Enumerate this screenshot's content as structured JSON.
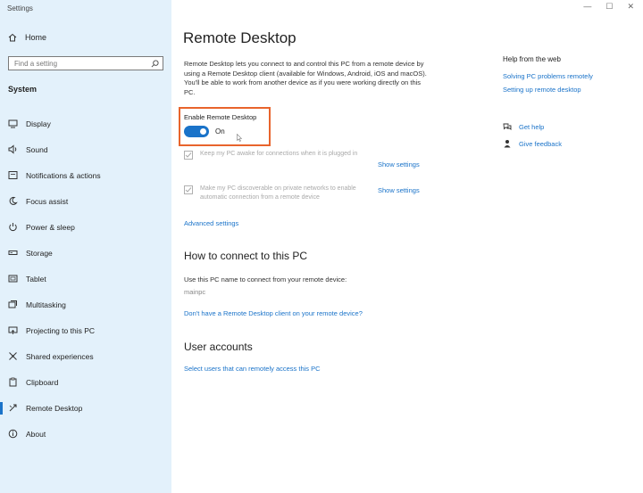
{
  "window": {
    "title": "Settings",
    "controls": [
      "—",
      "☐",
      "✕"
    ]
  },
  "sidebar": {
    "home_label": "Home",
    "search_placeholder": "Find a setting",
    "section": "System",
    "items": [
      {
        "label": "Display",
        "icon": "display-icon"
      },
      {
        "label": "Sound",
        "icon": "sound-icon"
      },
      {
        "label": "Notifications & actions",
        "icon": "notifications-icon"
      },
      {
        "label": "Focus assist",
        "icon": "moon-icon"
      },
      {
        "label": "Power & sleep",
        "icon": "power-icon"
      },
      {
        "label": "Storage",
        "icon": "storage-icon"
      },
      {
        "label": "Tablet",
        "icon": "tablet-icon"
      },
      {
        "label": "Multitasking",
        "icon": "multitasking-icon"
      },
      {
        "label": "Projecting to this PC",
        "icon": "projecting-icon"
      },
      {
        "label": "Shared experiences",
        "icon": "shared-icon"
      },
      {
        "label": "Clipboard",
        "icon": "clipboard-icon"
      },
      {
        "label": "Remote Desktop",
        "icon": "remote-desktop-icon",
        "active": true
      },
      {
        "label": "About",
        "icon": "info-icon"
      }
    ]
  },
  "main": {
    "title": "Remote Desktop",
    "description": "Remote Desktop lets you connect to and control this PC from a remote device by using a Remote Desktop client (available for Windows, Android, iOS and macOS). You'll be able to work from another device as if you were working directly on this PC.",
    "toggle": {
      "label": "Enable Remote Desktop",
      "state": "On",
      "on": true,
      "accent": "#1a73c9",
      "highlight": "#e8642c"
    },
    "options": [
      {
        "text": "Keep my PC awake for connections when it is plugged in",
        "link": "Show settings",
        "checked": true
      },
      {
        "text": "Make my PC discoverable on private networks to enable automatic connection from a remote device",
        "link": "Show settings",
        "checked": true
      }
    ],
    "advanced_link": "Advanced settings",
    "connect": {
      "heading": "How to connect to this PC",
      "text": "Use this PC name to connect from your remote device:",
      "pc_name": "mainpc",
      "client_link": "Don't have a Remote Desktop client on your remote device?"
    },
    "accounts": {
      "heading": "User accounts",
      "link": "Select users that can remotely access this PC"
    }
  },
  "help": {
    "title": "Help from the web",
    "links": [
      "Solving PC problems remotely",
      "Setting up remote desktop"
    ],
    "get_help": "Get help",
    "give_feedback": "Give feedback"
  }
}
